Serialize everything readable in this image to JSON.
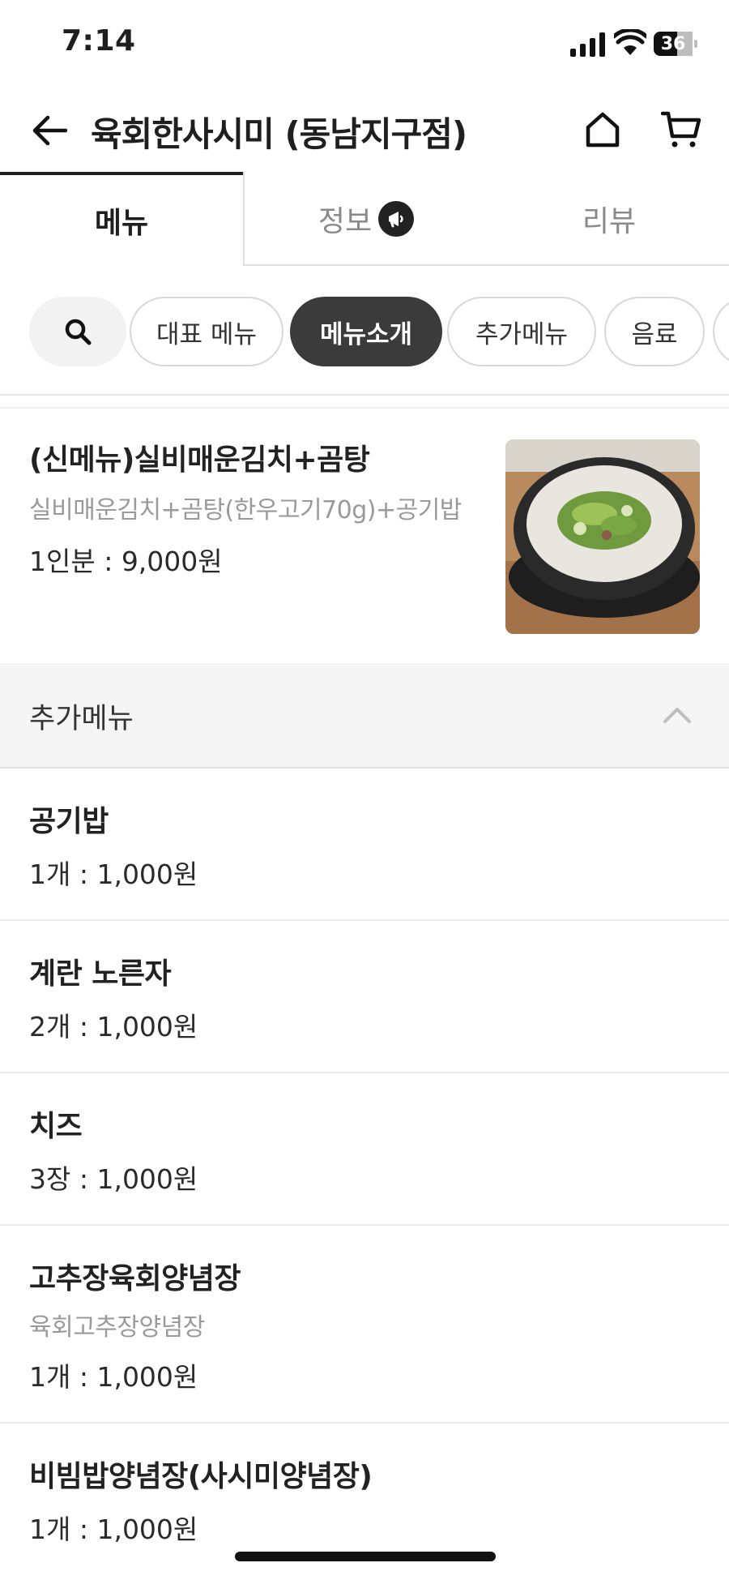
{
  "status_bar": {
    "time": "7:14",
    "battery": "36"
  },
  "header": {
    "title": "육회한사시미 (동남지구점)",
    "back_icon": "arrow-left-icon",
    "home_icon": "home-icon",
    "cart_icon": "cart-icon"
  },
  "tabs": [
    {
      "label": "메뉴",
      "selected": true
    },
    {
      "label": "정보",
      "selected": false,
      "icon": "megaphone-icon"
    },
    {
      "label": "리뷰",
      "selected": false
    }
  ],
  "category_chips": [
    {
      "label": "대표 메뉴",
      "selected": false
    },
    {
      "label": "메뉴소개",
      "selected": true
    },
    {
      "label": "추가메뉴",
      "selected": false
    },
    {
      "label": "음료",
      "selected": false
    }
  ],
  "featured_item": {
    "name": "(신메뉴)실비매운김치+곰탕",
    "description": "실비매운김치+곰탕(한우고기70g)+공기밥",
    "price": "1인분 : 9,000원"
  },
  "section": {
    "title": "추가메뉴",
    "expanded": true
  },
  "items": [
    {
      "name": "공기밥",
      "price": "1개 : 1,000원"
    },
    {
      "name": "계란 노른자",
      "price": "2개 : 1,000원"
    },
    {
      "name": "치즈",
      "price": "3장 : 1,000원"
    },
    {
      "name": "고추장육회양념장",
      "description": "육회고추장양념장",
      "price": "1개 : 1,000원"
    },
    {
      "name": "비빔밥양념장(사시미양념장)",
      "price": "1개 : 1,000원"
    }
  ],
  "colors": {
    "active_chip": "#3b3b3b",
    "section_bg": "#f5f5f5",
    "muted_text": "#9a9a9a"
  }
}
